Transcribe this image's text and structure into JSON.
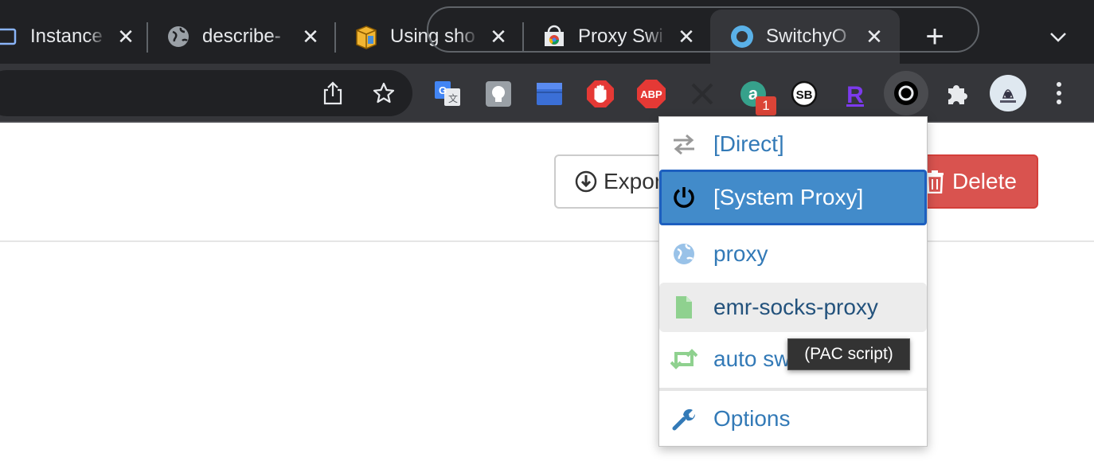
{
  "tabs": [
    {
      "title": "Instance t",
      "close": "✕"
    },
    {
      "title": "describe-",
      "close": "✕"
    },
    {
      "title": "Using sho",
      "close": "✕"
    },
    {
      "title": "Proxy Swi",
      "close": "✕"
    },
    {
      "title": "SwitchyO",
      "close": "✕"
    }
  ],
  "new_tab": "+",
  "extensions": {
    "abp_label": "ABP",
    "sb_label": "SB",
    "r_label": "R",
    "badge_count": "1"
  },
  "page": {
    "export_label": "Expor",
    "delete_label": "Delete"
  },
  "popup": {
    "items": [
      {
        "label": "[Direct]",
        "icon": "arrows-exchange-icon"
      },
      {
        "label": "[System Proxy]",
        "icon": "power-icon"
      },
      {
        "label": "proxy",
        "icon": "globe-icon"
      },
      {
        "label": "emr-socks-proxy",
        "icon": "file-icon"
      },
      {
        "label": "auto sw",
        "icon": "retweet-icon"
      },
      {
        "label": "Options",
        "icon": "wrench-icon"
      }
    ],
    "tooltip": "(PAC script)"
  },
  "colors": {
    "accent": "#428bca",
    "link": "#337ab7",
    "danger": "#d9534f"
  }
}
